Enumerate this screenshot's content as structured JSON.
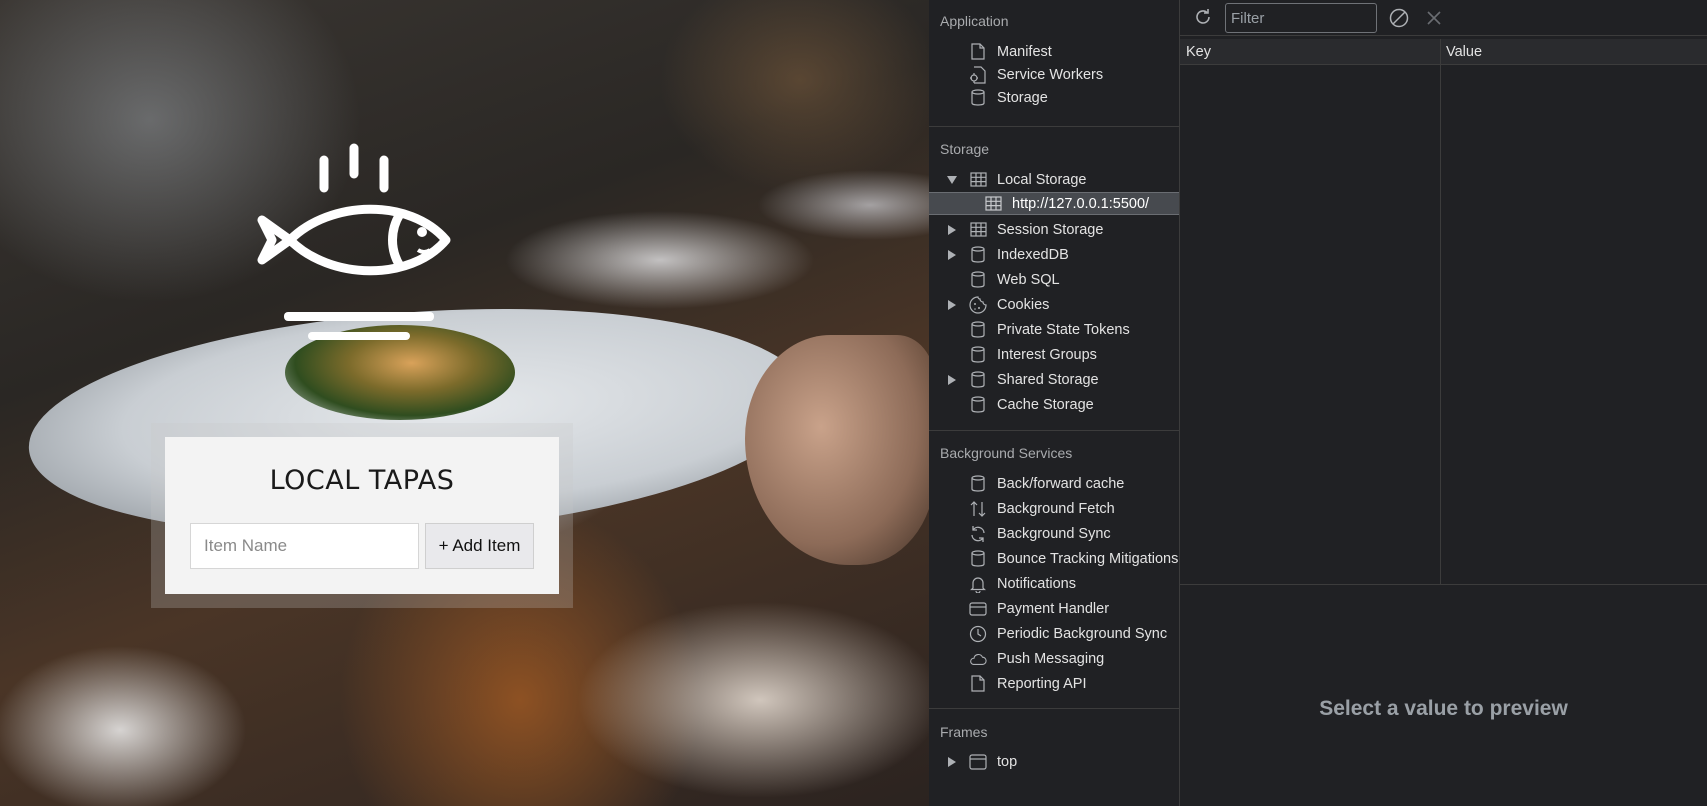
{
  "page": {
    "app_title": "LOCAL TAPAS",
    "item_input": {
      "placeholder": "Item Name",
      "value": ""
    },
    "add_button_label": "+ Add Item"
  },
  "devtools": {
    "sidebar": {
      "application": {
        "title": "Application",
        "items": [
          {
            "label": "Manifest",
            "icon": "file-icon"
          },
          {
            "label": "Service Workers",
            "icon": "gear-file-icon"
          },
          {
            "label": "Storage",
            "icon": "database-icon"
          }
        ]
      },
      "storage": {
        "title": "Storage",
        "items": [
          {
            "label": "Local Storage",
            "icon": "grid-icon",
            "expanded": true
          },
          {
            "label": "http://127.0.0.1:5500/",
            "icon": "grid-icon",
            "selected": true
          },
          {
            "label": "Session Storage",
            "icon": "grid-icon",
            "expanded": false
          },
          {
            "label": "IndexedDB",
            "icon": "database-icon",
            "expanded": false
          },
          {
            "label": "Web SQL",
            "icon": "database-icon"
          },
          {
            "label": "Cookies",
            "icon": "cookie-icon",
            "expanded": false
          },
          {
            "label": "Private State Tokens",
            "icon": "database-icon"
          },
          {
            "label": "Interest Groups",
            "icon": "database-icon"
          },
          {
            "label": "Shared Storage",
            "icon": "database-icon",
            "expanded": false
          },
          {
            "label": "Cache Storage",
            "icon": "database-icon"
          }
        ]
      },
      "background_services": {
        "title": "Background Services",
        "items": [
          {
            "label": "Back/forward cache",
            "icon": "database-icon"
          },
          {
            "label": "Background Fetch",
            "icon": "up-down-arrows-icon"
          },
          {
            "label": "Background Sync",
            "icon": "sync-icon"
          },
          {
            "label": "Bounce Tracking Mitigations",
            "icon": "database-icon"
          },
          {
            "label": "Notifications",
            "icon": "bell-icon"
          },
          {
            "label": "Payment Handler",
            "icon": "card-icon"
          },
          {
            "label": "Periodic Background Sync",
            "icon": "clock-icon"
          },
          {
            "label": "Push Messaging",
            "icon": "cloud-icon"
          },
          {
            "label": "Reporting API",
            "icon": "file-icon"
          }
        ]
      },
      "frames": {
        "title": "Frames",
        "items": [
          {
            "label": "top",
            "icon": "window-icon",
            "expanded": false
          }
        ]
      }
    },
    "main": {
      "filter_placeholder": "Filter",
      "columns": [
        "Key",
        "Value"
      ],
      "rows": [],
      "preview_message": "Select a value to preview"
    }
  }
}
